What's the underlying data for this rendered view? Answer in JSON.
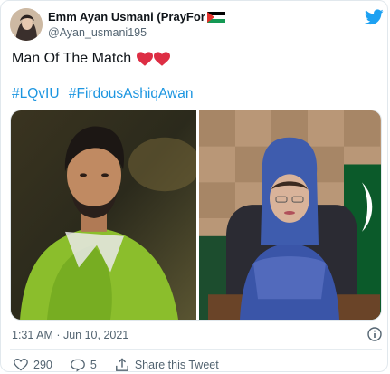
{
  "author": {
    "name": "Emm Ayan Usmani (PrayFor",
    "handle": "@Ayan_usmani195"
  },
  "tweet": {
    "text": "Man Of The Match",
    "hashtags": [
      "#LQvIU",
      "#FirdousAshiqAwan"
    ]
  },
  "meta": {
    "timestamp": "1:31 AM · Jun 10, 2021"
  },
  "actions": {
    "likes": "290",
    "replies": "5",
    "share_label": "Share this Tweet"
  },
  "colors": {
    "accent": "#1b95e0",
    "heart": "#e0245e",
    "text": "#0f1419",
    "muted": "#536471"
  },
  "icons": [
    "twitter-bird-icon",
    "palestine-flag-icon",
    "red-heart-icon",
    "info-icon",
    "heart-icon",
    "reply-icon",
    "share-icon"
  ]
}
